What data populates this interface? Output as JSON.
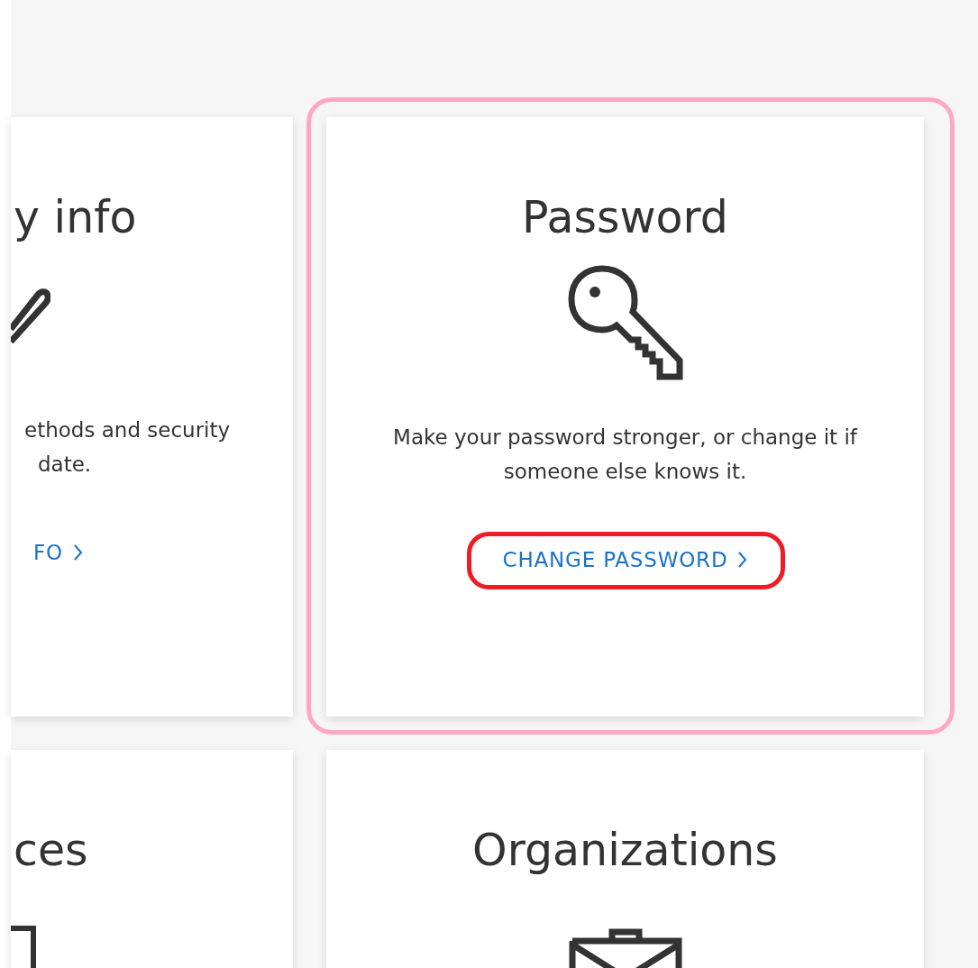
{
  "cards": [
    {
      "title": "y info",
      "description_lines": [
        "ethods and security",
        "date."
      ],
      "link": "FO",
      "highlighted": false
    },
    {
      "title": "Password",
      "description_lines": [
        "Make your password stronger, or change it if",
        "someone else knows it."
      ],
      "link": "CHANGE PASSWORD",
      "highlighted": true
    },
    {
      "title": "ces",
      "highlighted": false
    },
    {
      "title": "Organizations",
      "highlighted": false
    }
  ]
}
